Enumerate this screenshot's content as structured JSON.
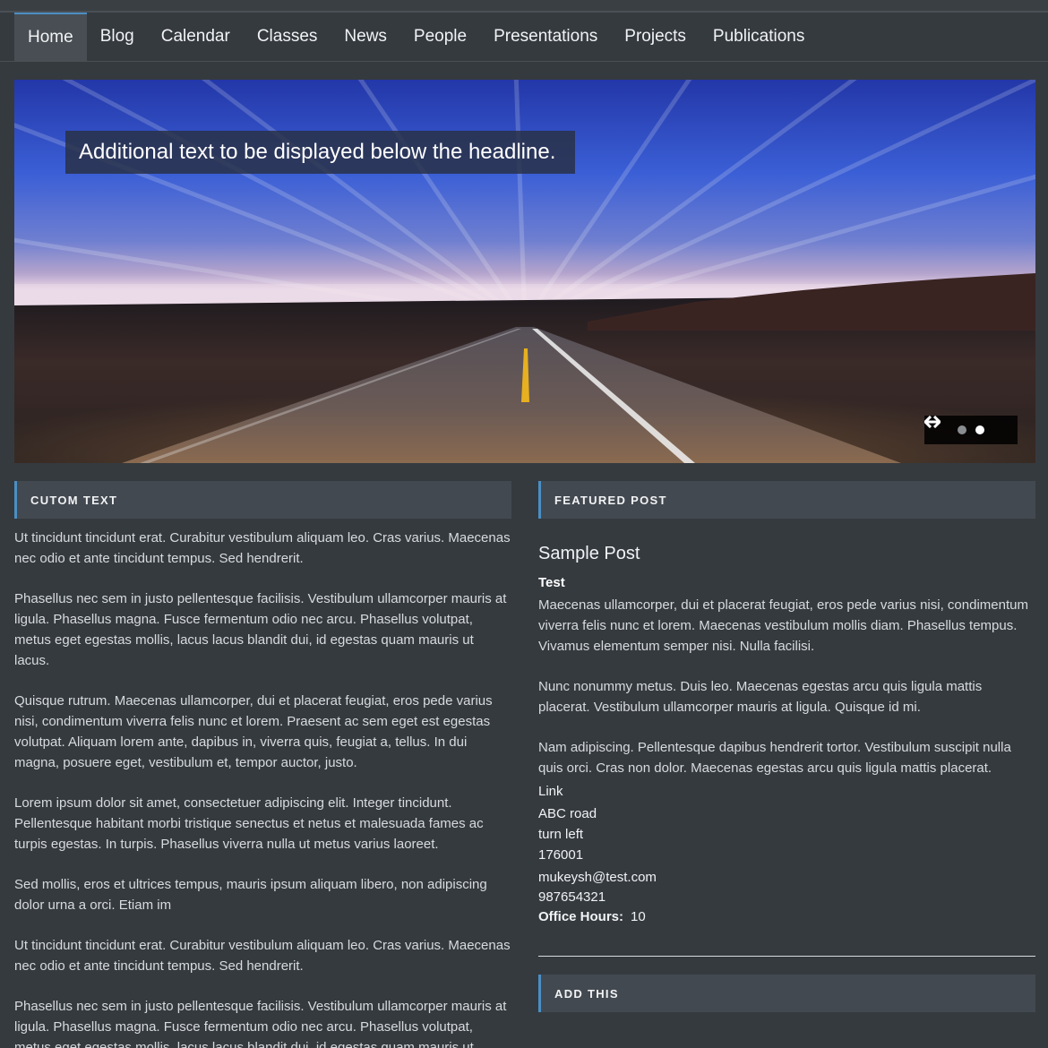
{
  "nav": {
    "items": [
      {
        "label": "Home"
      },
      {
        "label": "Blog"
      },
      {
        "label": "Calendar"
      },
      {
        "label": "Classes"
      },
      {
        "label": "News"
      },
      {
        "label": "People"
      },
      {
        "label": "Presentations"
      },
      {
        "label": "Projects"
      },
      {
        "label": "Publications"
      }
    ],
    "active_index": 0
  },
  "slider": {
    "caption": "Additional text to be displayed below the headline.",
    "slide_count": 2,
    "current_slide": 2,
    "prev_icon": "arrow-left-icon",
    "next_icon": "arrow-right-icon"
  },
  "custom_text": {
    "title": "CUTOM TEXT",
    "paragraphs": [
      "Ut tincidunt tincidunt erat. Curabitur vestibulum aliquam leo. Cras varius. Maecenas nec odio et ante tincidunt tempus. Sed hendrerit.",
      "Phasellus nec sem in justo pellentesque facilisis. Vestibulum ullamcorper mauris at ligula. Phasellus magna. Fusce fermentum odio nec arcu. Phasellus volutpat, metus eget egestas mollis, lacus lacus blandit dui, id egestas quam mauris ut lacus.",
      "Quisque rutrum. Maecenas ullamcorper, dui et placerat feugiat, eros pede varius nisi, condimentum viverra felis nunc et lorem. Praesent ac sem eget est egestas volutpat. Aliquam lorem ante, dapibus in, viverra quis, feugiat a, tellus. In dui magna, posuere eget, vestibulum et, tempor auctor, justo.",
      "Lorem ipsum dolor sit amet, consectetuer adipiscing elit. Integer tincidunt. Pellentesque habitant morbi tristique senectus et netus et malesuada fames ac turpis egestas. In turpis. Phasellus viverra nulla ut metus varius laoreet.",
      "Sed mollis, eros et ultrices tempus, mauris ipsum aliquam libero, non adipiscing dolor urna a orci. Etiam im",
      "Ut tincidunt tincidunt erat. Curabitur vestibulum aliquam leo. Cras varius. Maecenas nec odio et ante tincidunt tempus. Sed hendrerit.",
      "Phasellus nec sem in justo pellentesque facilisis. Vestibulum ullamcorper mauris at ligula. Phasellus magna. Fusce fermentum odio nec arcu. Phasellus volutpat, metus eget egestas mollis, lacus lacus blandit dui, id egestas quam mauris ut lacus."
    ]
  },
  "featured_post": {
    "title": "FEATURED POST",
    "post_title": "Sample Post",
    "subtitle": "Test",
    "paragraphs": [
      "Maecenas ullamcorper, dui et placerat feugiat, eros pede varius nisi, condimentum viverra felis nunc et lorem. Maecenas vestibulum mollis diam. Phasellus tempus. Vivamus elementum semper nisi. Nulla facilisi.",
      "Nunc nonummy metus. Duis leo. Maecenas egestas arcu quis ligula mattis placerat. Vestibulum ullamcorper mauris at ligula. Quisque id mi.",
      "Nam adipiscing. Pellentesque dapibus hendrerit tortor. Vestibulum suscipit nulla quis orci. Cras non dolor. Maecenas egestas arcu quis ligula mattis placerat."
    ],
    "link_label": "Link",
    "address": [
      "ABC road",
      "turn left",
      "176001"
    ],
    "email": "mukeysh@test.com",
    "phone": "987654321",
    "office_hours_label": "Office Hours:",
    "office_hours_value": "10"
  },
  "add_this": {
    "title": "ADD THIS"
  },
  "colors": {
    "background": "#353a3f",
    "accent": "#4b8fc4",
    "widget_header": "#434950"
  }
}
